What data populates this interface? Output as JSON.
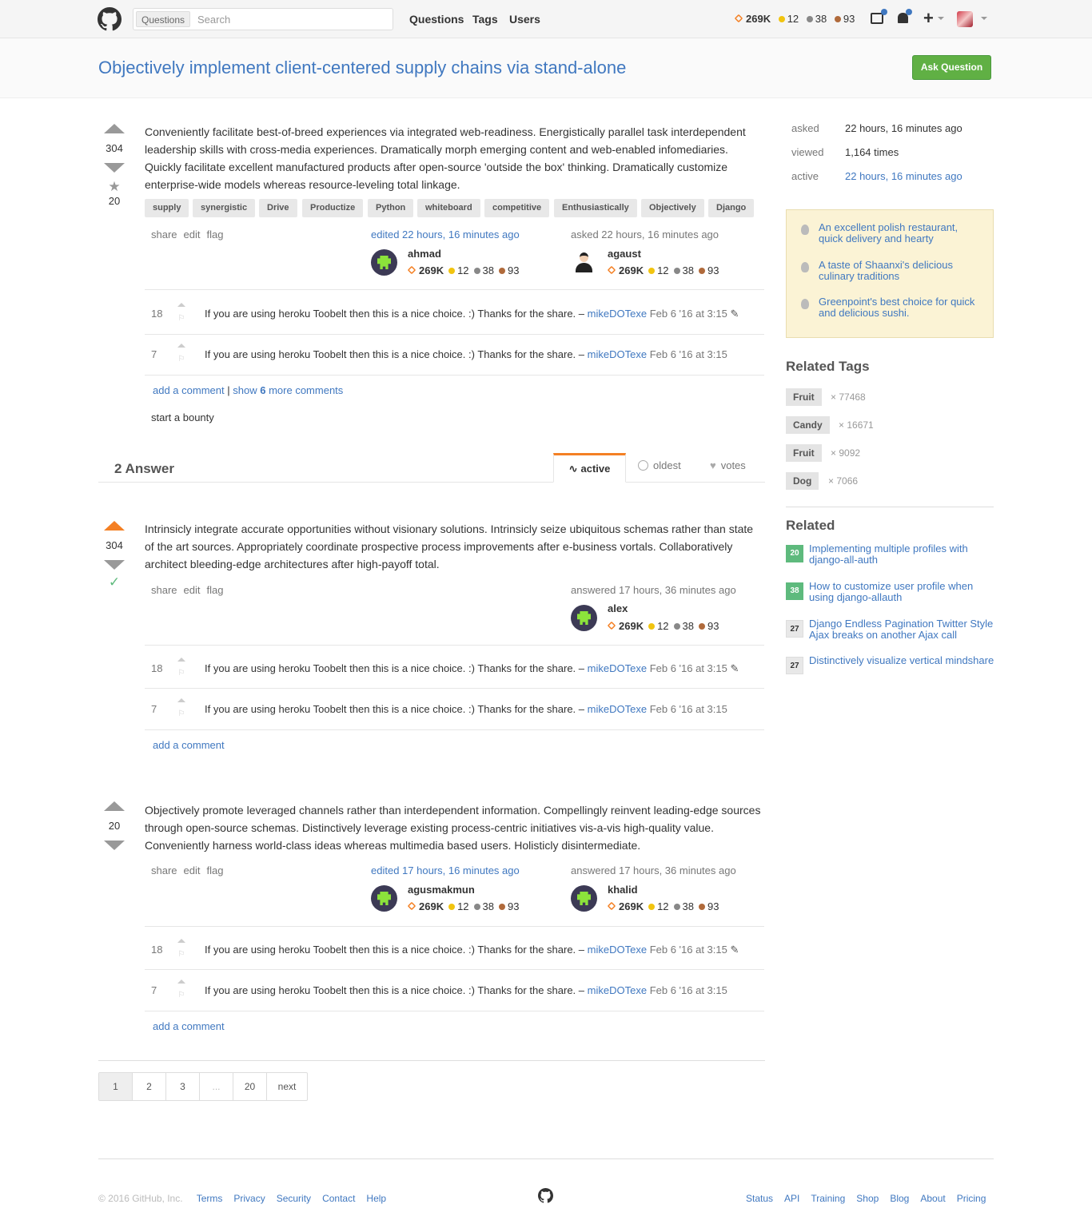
{
  "header": {
    "search_scope": "Questions",
    "search_placeholder": "Search",
    "nav": [
      "Questions",
      "Tags",
      "Users"
    ],
    "rep": "269K",
    "gold": "12",
    "silver": "38",
    "bronze": "93"
  },
  "question": {
    "title": "Objectively implement client-centered supply chains via stand-alone",
    "ask_button": "Ask Question",
    "votes": "304",
    "favorites": "20",
    "body": "Conveniently facilitate best-of-breed experiences via integrated web-readiness. Energistically parallel task interdependent leadership skills with cross-media experiences. Dramatically morph emerging content and web-enabled infomediaries. Quickly facilitate excellent manufactured products after open-source 'outside the box' thinking. Dramatically customize enterprise-wide models whereas resource-leveling total linkage.",
    "tags": [
      "supply",
      "synergistic",
      "Drive",
      "Productize",
      "Python",
      "whiteboard",
      "competitive",
      "Enthusiastically",
      "Objectively",
      "Django"
    ],
    "menu": [
      "share",
      "edit",
      "flag"
    ],
    "edited": "edited 22 hours, 16 minutes ago",
    "editor": {
      "name": "ahmad",
      "rep": "269K",
      "gold": "12",
      "silver": "38",
      "bronze": "93"
    },
    "asked": "asked 22 hours, 16 minutes ago",
    "asker": {
      "name": "agaust",
      "rep": "269K",
      "gold": "12",
      "silver": "38",
      "bronze": "93"
    },
    "comments": [
      {
        "score": "18",
        "text": "If you are using heroku Toobelt then this is a nice choice. :) Thanks for the share. –",
        "user": "mikeDOTexe",
        "when": "Feb 6 '16 at 3:15"
      },
      {
        "score": "7",
        "text": "If you are using heroku Toobelt then this is a nice choice. :) Thanks for the share. –",
        "user": "mikeDOTexe",
        "when": "Feb 6 '16 at 3:15"
      }
    ],
    "add_comment": "add a comment",
    "sep": "|",
    "show_more_pre": "show",
    "show_more_num": "6",
    "show_more_post": "more comments",
    "bounty": "start a bounty"
  },
  "answers_header": {
    "count": "2 Answer",
    "tabs": [
      "active",
      "oldest",
      "votes"
    ]
  },
  "answers": [
    {
      "votes": "304",
      "body": "Intrinsicly integrate accurate opportunities without visionary solutions. Intrinsicly seize ubiquitous schemas rather than state of the art sources. Appropriately coordinate prospective process improvements after e-business vortals. Collaboratively architect bleeding-edge architectures after high-payoff total.",
      "answered": "answered 17 hours, 36 minutes ago",
      "author": {
        "name": "alex",
        "rep": "269K",
        "gold": "12",
        "silver": "38",
        "bronze": "93"
      },
      "comments": [
        {
          "score": "18",
          "text": "If you are using heroku Toobelt then this is a nice choice. :) Thanks for the share. –",
          "user": "mikeDOTexe",
          "when": "Feb 6 '16 at 3:15"
        },
        {
          "score": "7",
          "text": "If you are using heroku Toobelt then this is a nice choice. :) Thanks for the share. –",
          "user": "mikeDOTexe",
          "when": "Feb 6 '16 at 3:15"
        }
      ],
      "add_comment": "add a comment"
    },
    {
      "votes": "20",
      "body": "Objectively promote leveraged channels rather than interdependent information. Compellingly reinvent leading-edge sources through open-source schemas. Distinctively leverage existing process-centric initiatives vis-a-vis high-quality value. Conveniently harness world-class ideas whereas multimedia based users. Holisticly disintermediate.",
      "edited": "edited 17 hours, 16 minutes ago",
      "editor": {
        "name": "agusmakmun",
        "rep": "269K",
        "gold": "12",
        "silver": "38",
        "bronze": "93"
      },
      "answered": "answered 17 hours, 36 minutes ago",
      "author": {
        "name": "khalid",
        "rep": "269K",
        "gold": "12",
        "silver": "38",
        "bronze": "93"
      },
      "comments": [
        {
          "score": "18",
          "text": "If you are using heroku Toobelt then this is a nice choice. :) Thanks for the share. –",
          "user": "mikeDOTexe",
          "when": "Feb 6 '16 at 3:15"
        },
        {
          "score": "7",
          "text": "If you are using heroku Toobelt then this is a nice choice. :) Thanks for the share. –",
          "user": "mikeDOTexe",
          "when": "Feb 6 '16 at 3:15"
        }
      ],
      "add_comment": "add a comment"
    }
  ],
  "menu": [
    "share",
    "edit",
    "flag"
  ],
  "sidebar": {
    "stats": [
      {
        "k": "asked",
        "v": "22 hours, 16 minutes ago"
      },
      {
        "k": "viewed",
        "v": "1,164 times"
      },
      {
        "k": "active",
        "v": "22 hours, 16 minutes ago"
      }
    ],
    "hot": [
      "An excellent polish restaurant, quick delivery and hearty",
      "A taste of Shaanxi's delicious culinary traditions",
      "Greenpoint's best choice for quick and delicious sushi."
    ],
    "related_tags_title": "Related Tags",
    "related_tags": [
      {
        "name": "Fruit",
        "count": "× 77468"
      },
      {
        "name": "Candy",
        "count": "× 16671"
      },
      {
        "name": "Fruit",
        "count": "× 9092"
      },
      {
        "name": "Dog",
        "count": "× 7066"
      }
    ],
    "related_title": "Related",
    "related": [
      {
        "score": "20",
        "title": "Implementing multiple profiles with django-all-auth"
      },
      {
        "score": "38",
        "title": "How to customize user profile when using django-allauth"
      },
      {
        "score": "27",
        "title": "Django Endless Pagination Twitter Style Ajax breaks on another Ajax call"
      },
      {
        "score": "27",
        "title": "Distinctively visualize vertical mindshare"
      }
    ]
  },
  "pagination": [
    "1",
    "2",
    "3",
    "...",
    "20",
    "next"
  ],
  "footer": {
    "copyright": "© 2016 GitHub, Inc.",
    "left": [
      "Terms",
      "Privacy",
      "Security",
      "Contact",
      "Help"
    ],
    "right": [
      "Status",
      "API",
      "Training",
      "Shop",
      "Blog",
      "About",
      "Pricing"
    ]
  },
  "colors": {
    "accent": "#4078c0",
    "orange": "#f48024",
    "green": "#60b044"
  }
}
